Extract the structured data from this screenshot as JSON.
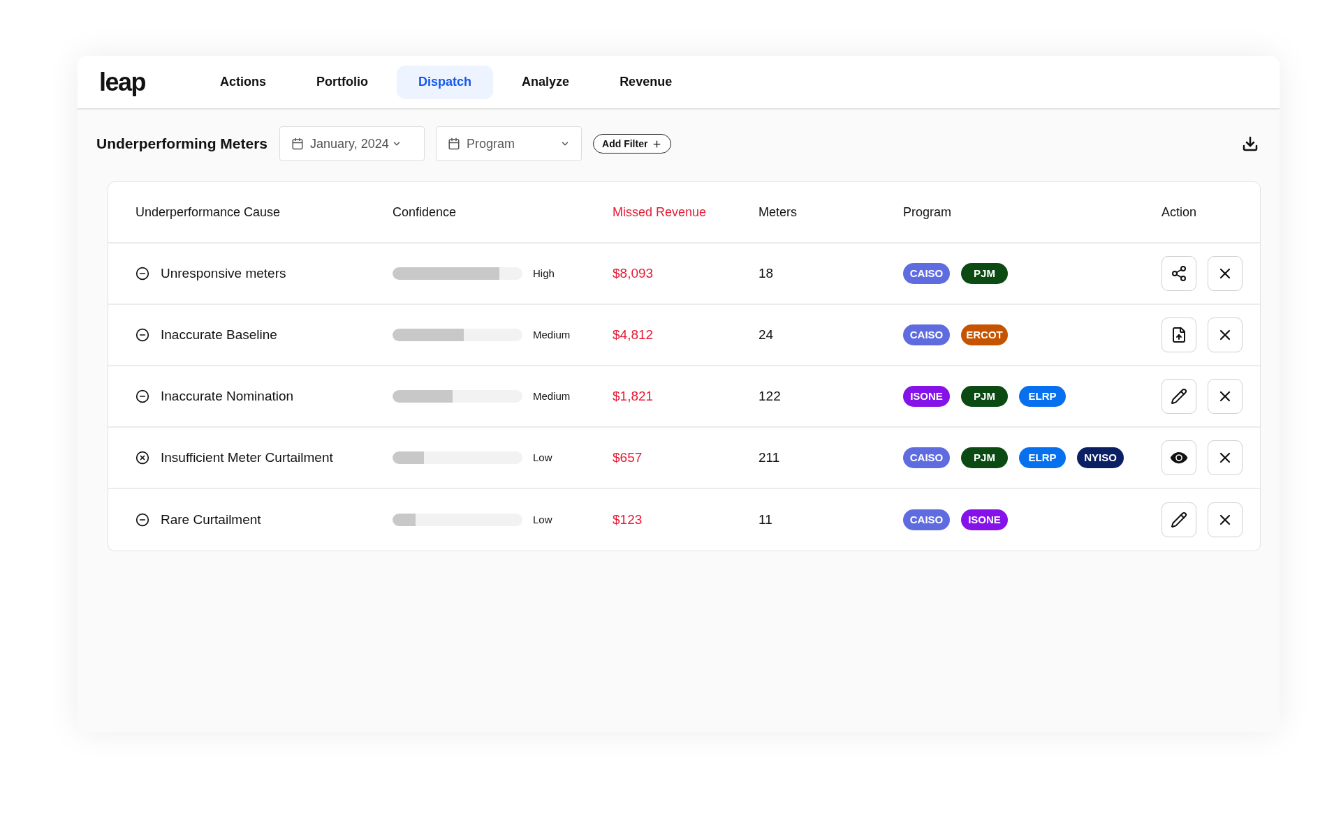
{
  "nav": {
    "logo": "leap",
    "tabs": [
      {
        "label": "Actions",
        "selected": false
      },
      {
        "label": "Portfolio",
        "selected": false
      },
      {
        "label": "Dispatch",
        "selected": true
      },
      {
        "label": "Analyze",
        "selected": false
      },
      {
        "label": "Revenue",
        "selected": false
      }
    ]
  },
  "toolbar": {
    "title": "Underperforming Meters",
    "date_filter": {
      "value": "January, 2024"
    },
    "program_filter": {
      "placeholder": "Program"
    },
    "add_filter": "Add Filter"
  },
  "table": {
    "columns": [
      {
        "label": "Underperformance Cause",
        "selected": false
      },
      {
        "label": "Confidence",
        "selected": false
      },
      {
        "label": "Missed Revenue",
        "selected": true
      },
      {
        "label": "Meters",
        "selected": false
      },
      {
        "label": "Program",
        "selected": false
      },
      {
        "label": "Action",
        "selected": false
      }
    ],
    "rows": [
      {
        "cause": {
          "text": "Unresponsive meters",
          "kind": "minus"
        },
        "confidence": {
          "level": 0.82,
          "label": "High"
        },
        "missed_revenue": "$8,093",
        "meters": "18",
        "programs": [
          {
            "name": "CAISO",
            "color": "#5f6ce0"
          },
          {
            "name": "PJM",
            "color": "#0b4a12"
          }
        ],
        "action": {
          "kind": "share"
        }
      },
      {
        "cause": {
          "text": "Inaccurate Baseline",
          "kind": "minus"
        },
        "confidence": {
          "level": 0.55,
          "label": "Medium"
        },
        "missed_revenue": "$4,812",
        "meters": "24",
        "programs": [
          {
            "name": "CAISO",
            "color": "#5f6ce0"
          },
          {
            "name": "ERCOT",
            "color": "#c65300"
          }
        ],
        "action": {
          "kind": "upload"
        }
      },
      {
        "cause": {
          "text": "Inaccurate Nomination",
          "kind": "minus"
        },
        "confidence": {
          "level": 0.46,
          "label": "Medium"
        },
        "missed_revenue": "$1,821",
        "meters": "122",
        "programs": [
          {
            "name": "ISONE",
            "color": "#8612ea"
          },
          {
            "name": "PJM",
            "color": "#0b4a12"
          },
          {
            "name": "ELRP",
            "color": "#0670ee"
          }
        ],
        "action": {
          "kind": "edit"
        }
      },
      {
        "cause": {
          "text": "Insufficient Meter Curtailment",
          "kind": "cross"
        },
        "confidence": {
          "level": 0.24,
          "label": "Low"
        },
        "missed_revenue": "$657",
        "meters": "211",
        "programs": [
          {
            "name": "CAISO",
            "color": "#5f6ce0"
          },
          {
            "name": "PJM",
            "color": "#0b4a12"
          },
          {
            "name": "ELRP",
            "color": "#0670ee"
          },
          {
            "name": "NYISO",
            "color": "#0b1f63"
          }
        ],
        "action": {
          "kind": "view"
        }
      },
      {
        "cause": {
          "text": "Rare Curtailment",
          "kind": "minus"
        },
        "confidence": {
          "level": 0.18,
          "label": "Low"
        },
        "missed_revenue": "$123",
        "meters": "11",
        "programs": [
          {
            "name": "CAISO",
            "color": "#5f6ce0"
          },
          {
            "name": "ISONE",
            "color": "#8612ea"
          }
        ],
        "action": {
          "kind": "edit"
        }
      }
    ]
  }
}
